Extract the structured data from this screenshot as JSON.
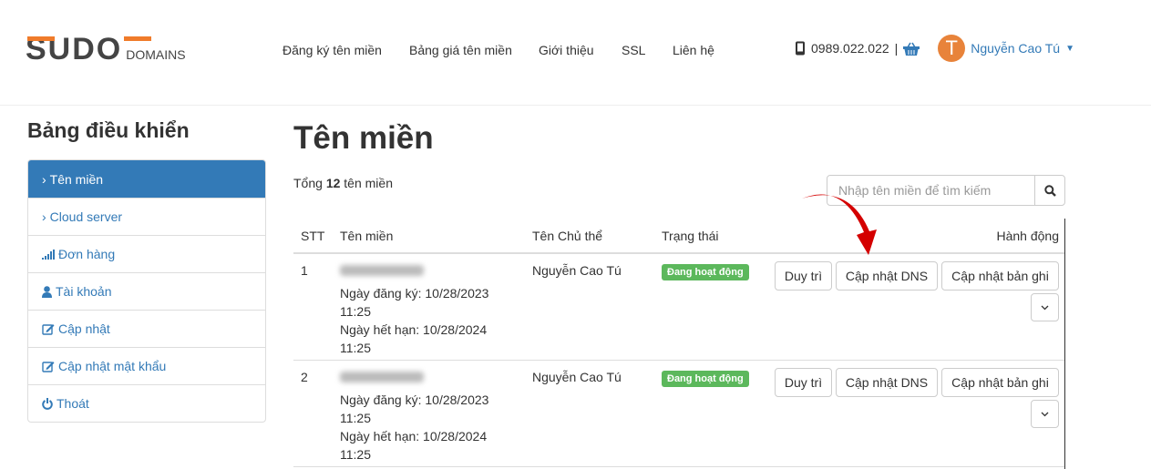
{
  "header": {
    "logo": "SUDO DOMAINS",
    "logo_main": "SUDO",
    "logo_sub": "DOMAINS",
    "nav": [
      "Đăng ký tên miền",
      "Bảng giá tên miền",
      "Giới thiệu",
      "SSL",
      "Liên hệ"
    ],
    "phone": "0989.022.022",
    "separator": "|",
    "avatar_letter": "T",
    "user_name": "Nguyễn Cao Tú"
  },
  "sidebar": {
    "title": "Bảng điều khiển",
    "items": [
      {
        "label": "Tên miền",
        "icon": "chevron-right-icon"
      },
      {
        "label": "Cloud server",
        "icon": "chevron-right-icon"
      },
      {
        "label": "Đơn hàng",
        "icon": "signal-icon"
      },
      {
        "label": "Tài khoản",
        "icon": "user-icon"
      },
      {
        "label": "Cập nhật",
        "icon": "edit-icon"
      },
      {
        "label": "Cập nhật mật khẩu",
        "icon": "edit-icon"
      },
      {
        "label": "Thoát",
        "icon": "power-icon"
      }
    ]
  },
  "main": {
    "title": "Tên miền",
    "total_prefix": "Tổng ",
    "total_count": "12",
    "total_suffix": " tên miền",
    "search_placeholder": "Nhập tên miền để tìm kiếm",
    "columns": [
      "STT",
      "Tên miền",
      "Tên Chủ thể",
      "Trạng thái",
      "Hành động"
    ],
    "rows": [
      {
        "stt": "1",
        "reg_label": "Ngày đăng ký: 10/28/2023",
        "reg_time": "11:25",
        "exp_label": "Ngày hết hạn: 10/28/2024",
        "exp_time": "11:25",
        "owner": "Nguyễn Cao Tú",
        "status": "Đang hoạt động"
      },
      {
        "stt": "2",
        "reg_label": "Ngày đăng ký: 10/28/2023",
        "reg_time": "11:25",
        "exp_label": "Ngày hết hạn: 10/28/2024",
        "exp_time": "11:25",
        "owner": "Nguyễn Cao Tú",
        "status": "Đang hoạt động"
      }
    ],
    "actions": {
      "renew": "Duy trì",
      "dns": "Cập nhật DNS",
      "records": "Cập nhật bản ghi"
    }
  },
  "colors": {
    "primary": "#337ab7",
    "accent": "#f07b2a",
    "success": "#5cb85c",
    "arrow": "#d40000"
  }
}
